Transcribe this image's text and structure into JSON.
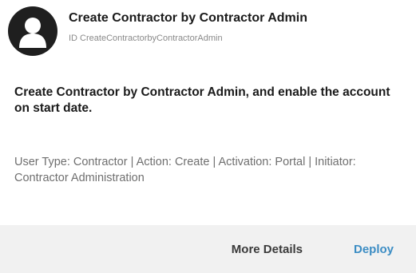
{
  "card": {
    "avatar_icon": "user-silhouette-icon",
    "title": "Create Contractor by Contractor Admin",
    "id_text": "ID CreateContractorbyContractorAdmin",
    "description": "Create Contractor by Contractor Admin, and enable the account on start date.",
    "meta": "User Type: Contractor | Action: Create | Activation: Portal | Initiator: Contractor Administration"
  },
  "footer": {
    "more_details_label": "More Details",
    "deploy_label": "Deploy"
  },
  "colors": {
    "accent": "#3c8dc4",
    "footer_background": "#f1f1f1",
    "avatar_background": "#1f1f1f"
  }
}
